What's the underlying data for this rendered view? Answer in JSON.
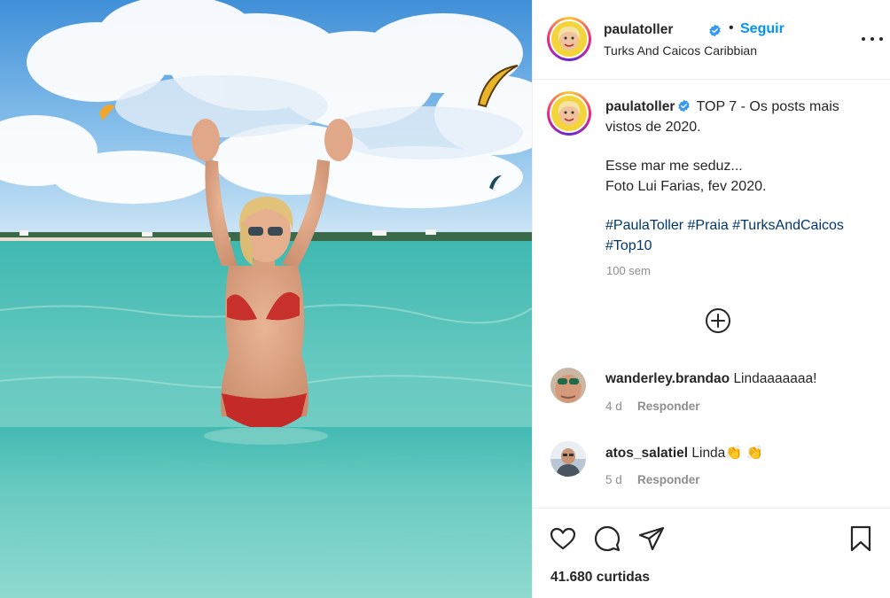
{
  "post": {
    "username": "paulatoller",
    "follow_label": "Seguir",
    "location": "Turks And Caicos Caribbian",
    "caption_line1": "TOP 7 - Os posts mais vistos de 2020.",
    "caption_line2": "Esse mar me seduz...",
    "caption_line3": "Foto Lui Farias, fev 2020.",
    "hashtags": [
      "#PaulaToller",
      "#Praia",
      "#TurksAndCaicos",
      "#Top10"
    ],
    "time": "100 sem",
    "likes": "41.680 curtidas"
  },
  "comments": [
    {
      "username": "wanderley.brandao",
      "text": "Lindaaaaaaa!",
      "time": "4 d",
      "reply_label": "Responder"
    },
    {
      "username": "atos_salatiel",
      "text": "Linda👏 👏",
      "time": "5 d",
      "reply_label": "Responder"
    }
  ],
  "icons": {
    "verified": "verified-badge-icon",
    "more": "more-options-icon",
    "add_comment": "plus-circle-icon",
    "like": "heart-icon",
    "comment": "comment-bubble-icon",
    "share": "paper-plane-icon",
    "save": "bookmark-icon"
  },
  "colors": {
    "link_blue": "#0095f6",
    "hashtag_blue": "#00376b",
    "muted_gray": "#8e8e8e",
    "verified_blue": "#3897f0"
  }
}
